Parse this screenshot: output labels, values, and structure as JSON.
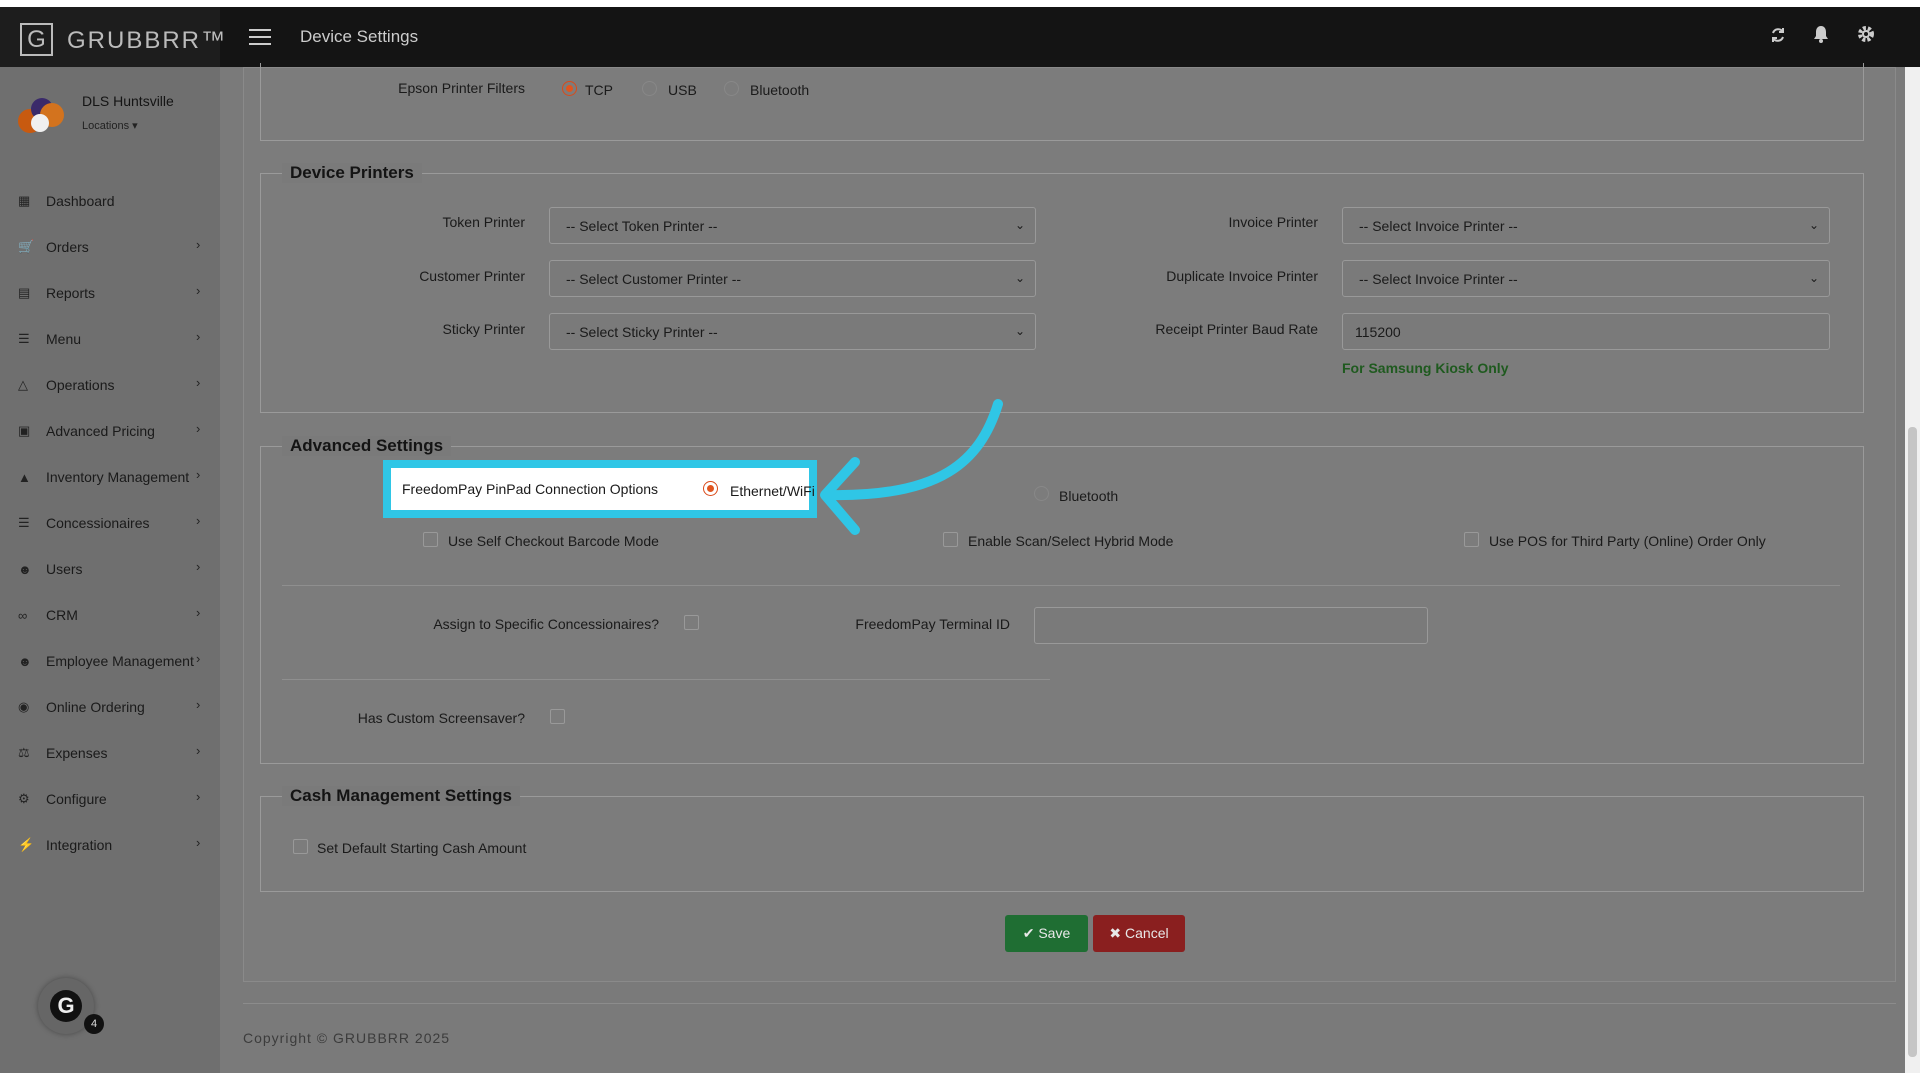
{
  "brand": {
    "logo_letter": "G",
    "name": "GRUBBRR™"
  },
  "header": {
    "title": "Device Settings"
  },
  "profile": {
    "name": "DLS Huntsville",
    "locations_label": "Locations"
  },
  "sidebar": {
    "items": [
      {
        "label": "Dashboard",
        "icon": "dashboard-icon",
        "chevron": false
      },
      {
        "label": "Orders",
        "icon": "cart-icon",
        "chevron": true
      },
      {
        "label": "Reports",
        "icon": "report-icon",
        "chevron": true
      },
      {
        "label": "Menu",
        "icon": "menu-list-icon",
        "chevron": true
      },
      {
        "label": "Operations",
        "icon": "flask-icon",
        "chevron": true
      },
      {
        "label": "Advanced Pricing",
        "icon": "money-icon",
        "chevron": true
      },
      {
        "label": "Inventory Management",
        "icon": "sitemap-icon",
        "chevron": true
      },
      {
        "label": "Concessionaires",
        "icon": "list-icon",
        "chevron": true
      },
      {
        "label": "Users",
        "icon": "user-plus-icon",
        "chevron": true
      },
      {
        "label": "CRM",
        "icon": "link-icon",
        "chevron": true
      },
      {
        "label": "Employee Management",
        "icon": "users-icon",
        "chevron": true
      },
      {
        "label": "Online Ordering",
        "icon": "globe-icon",
        "chevron": true
      },
      {
        "label": "Expenses",
        "icon": "balance-icon",
        "chevron": true
      },
      {
        "label": "Configure",
        "icon": "gear-icon",
        "chevron": true
      },
      {
        "label": "Integration",
        "icon": "plug-icon",
        "chevron": true
      }
    ]
  },
  "grammarly": {
    "letter": "G",
    "count": "4"
  },
  "epson": {
    "label": "Epson Printer Filters",
    "options": [
      "TCP",
      "USB",
      "Bluetooth"
    ],
    "selected": "TCP"
  },
  "device_printers": {
    "legend": "Device Printers",
    "token_label": "Token Printer",
    "token_value": "-- Select Token Printer --",
    "customer_label": "Customer Printer",
    "customer_value": "-- Select Customer Printer --",
    "sticky_label": "Sticky Printer",
    "sticky_value": "-- Select Sticky Printer --",
    "invoice_label": "Invoice Printer",
    "invoice_value": "-- Select Invoice Printer --",
    "dup_invoice_label": "Duplicate Invoice Printer",
    "dup_invoice_value": "-- Select Invoice Printer --",
    "baud_label": "Receipt Printer Baud Rate",
    "baud_value": "115200",
    "samsung_note": "For Samsung Kiosk Only"
  },
  "advanced": {
    "legend": "Advanced Settings",
    "freedompay_label": "FreedomPay PinPad Connection Options",
    "conn_option_ethernet": "Ethernet/WiFi",
    "conn_option_bluetooth": "Bluetooth",
    "self_checkout": "Use Self Checkout Barcode Mode",
    "hybrid_mode": "Enable Scan/Select Hybrid Mode",
    "third_party": "Use POS for Third Party (Online) Order Only",
    "assign_label": "Assign to Specific Concessionaires?",
    "terminal_label": "FreedomPay Terminal ID",
    "terminal_value": "",
    "screensaver_label": "Has Custom Screensaver?"
  },
  "cash": {
    "legend": "Cash Management Settings",
    "default_amount": "Set Default Starting Cash Amount"
  },
  "actions": {
    "save": "Save",
    "cancel": "Cancel"
  },
  "footer": {
    "copyright": "Copyright © GRUBBRR 2025"
  },
  "colors": {
    "highlight": "#2fc6e6",
    "radio_selected": "#e0551f",
    "save": "#1f6e33",
    "cancel": "#8a1f1f",
    "note": "#1f5a1f"
  }
}
